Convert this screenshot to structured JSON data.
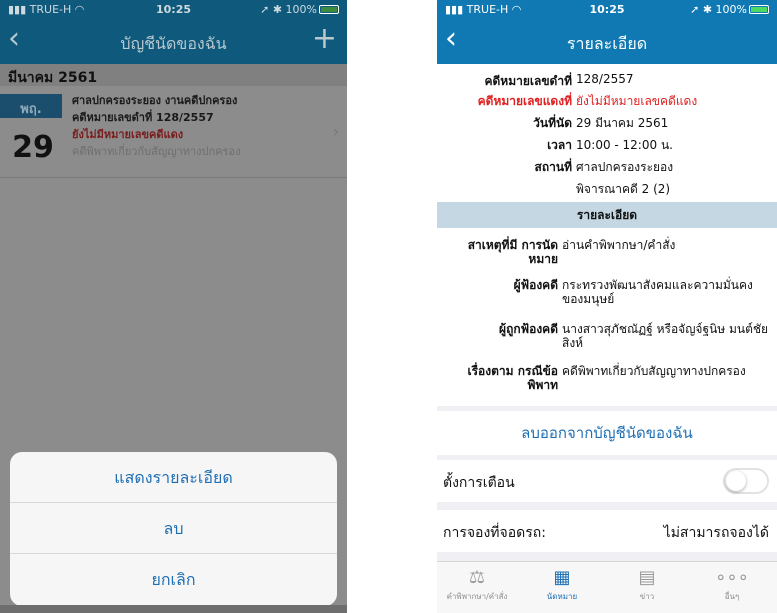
{
  "status_bar": {
    "carrier": "TRUE-H",
    "time": "10:25",
    "battery": "100%"
  },
  "left": {
    "nav_title": "บัญชีนัดของฉัน",
    "month_header": "มีนาคม 2561",
    "appointment": {
      "day_abbr": "พฤ.",
      "day_number": "29",
      "court": "ศาลปกครองระยอง งานคดีปกครอง",
      "case_label": "คดีหมายเลขดำที่ 128/2557",
      "red_case": "ยังไม่มีหมายเลขคดีแดง",
      "case_type": "คดีพิพาทเกี่ยวกับสัญญาทางปกครอง"
    },
    "action_sheet": [
      "แสดงรายละเอียด",
      "ลบ",
      "ยกเลิก"
    ],
    "tabbar_text": "คำพิพากษา/คำสั่ง   นัดหมาย   ข่าว   อื่นๆ"
  },
  "right": {
    "nav_title": "รายละเอียด",
    "top": [
      {
        "key": "คดีหมายเลขดำที่",
        "value": "128/2557"
      },
      {
        "key": "คดีหมายเลขแดงที่",
        "value": "ยังไม่มีหมายเลขคดีแดง"
      },
      {
        "key": "วันที่นัด",
        "value": "29 มีนาคม 2561"
      },
      {
        "key": "เวลา",
        "value": "10:00 - 12:00 น."
      },
      {
        "key": "สถานที่",
        "value": "ศาลปกครองระยอง"
      },
      {
        "key": "",
        "value": "พิจารณาคดี 2 (2)"
      }
    ],
    "section_title": "รายละเอียด",
    "details": [
      {
        "key": "สาเหตุที่มี การนัดหมาย",
        "value": "อ่านคำพิพากษา/คำสั่ง"
      },
      {
        "key": "ผู้ฟ้องคดี",
        "value": "กระทรวงพัฒนาสังคมและความมั่นคงของมนุษย์"
      },
      {
        "key": "ผู้ถูกฟ้องคดี",
        "value": "นางสาวสุภัชณัฏฐ์ หรือจัญจ์ฐนิษ มนต์ชัยสิงห์"
      },
      {
        "key": "เรื่องตาม กรณีข้อพิพาท",
        "value": "คดีพิพาทเกี่ยวกับสัญญาทางปกครอง"
      }
    ],
    "remove_button": "ลบออกจากบัญชีนัดของฉัน",
    "alert_label": "ตั้งการเตือน",
    "alert_on": false,
    "parking_label": "การจองที่จอดรถ:",
    "parking_value": "ไม่สามารถจองได้",
    "tabs": [
      {
        "label": "คำพิพากษา/คำสั่ง",
        "icon": "gavel-icon"
      },
      {
        "label": "นัดหมาย",
        "icon": "calendar-icon"
      },
      {
        "label": "ข่าว",
        "icon": "news-icon"
      },
      {
        "label": "อื่นๆ",
        "icon": "more-icon"
      }
    ]
  },
  "colors": {
    "nav_blue": "#1079b3",
    "link_blue": "#1f6fb5",
    "red": "#e02020",
    "section_blue": "#c4d7e2"
  }
}
